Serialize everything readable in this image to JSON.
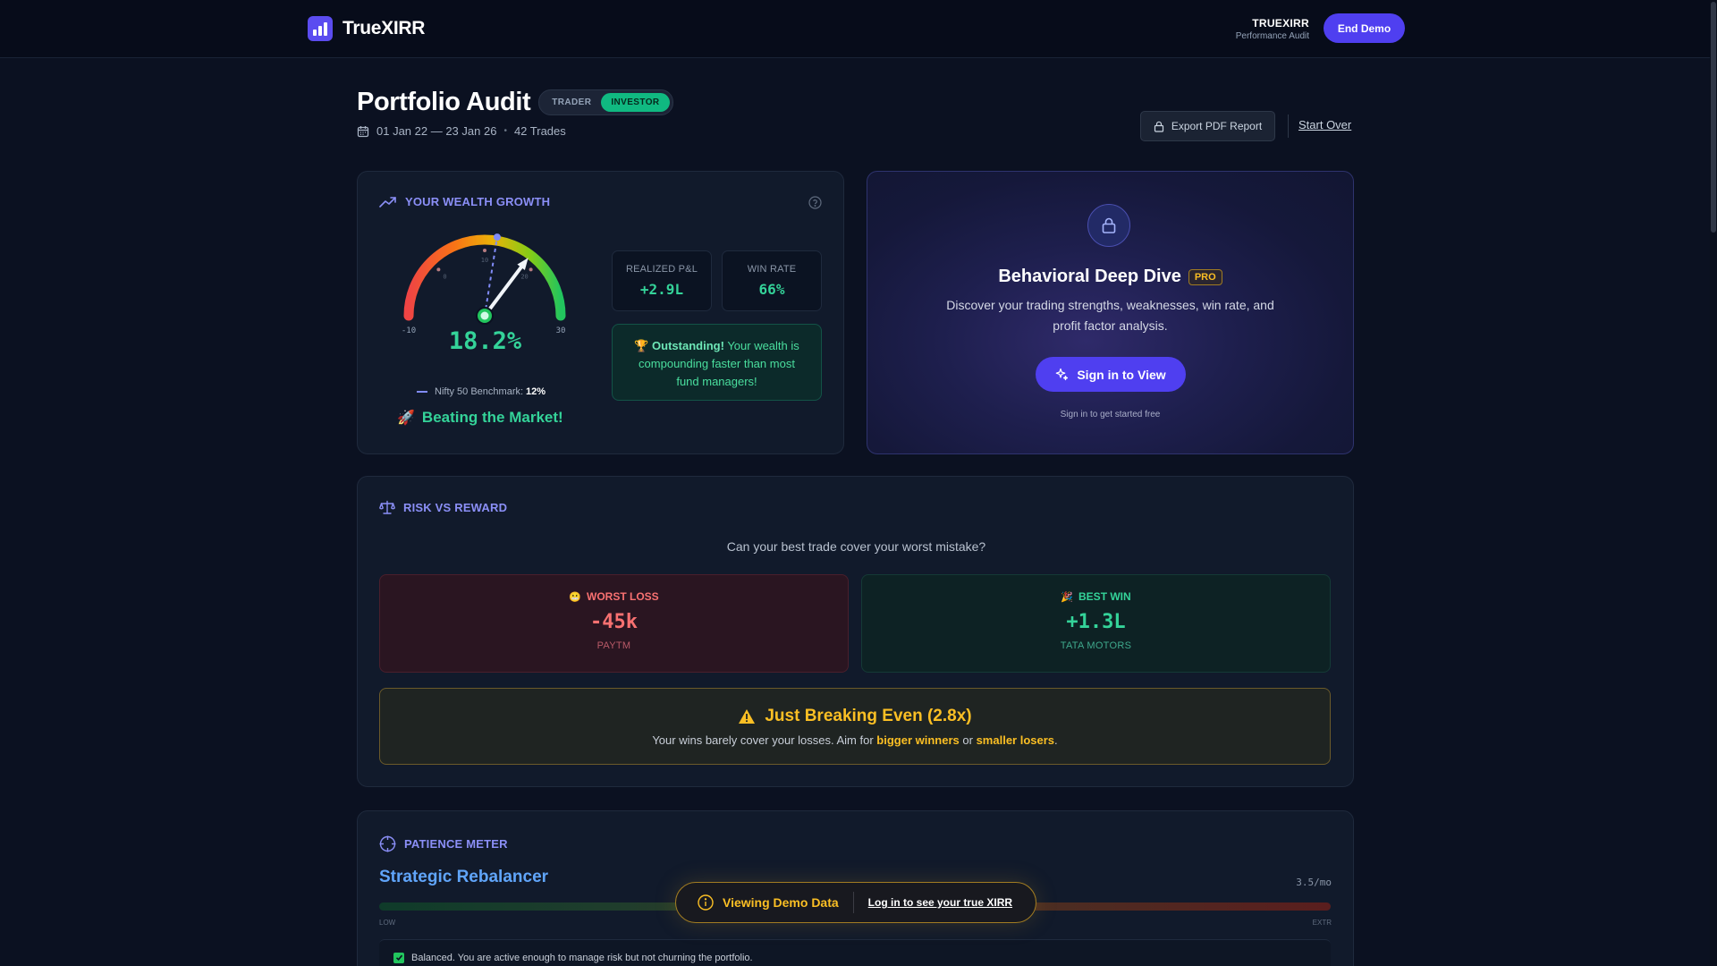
{
  "nav": {
    "logo_text": "TrueXIRR",
    "brand_title": "TRUEXIRR",
    "brand_subtitle": "Performance Audit",
    "end_demo_label": "End Demo"
  },
  "header": {
    "title": "Portfolio Audit",
    "mode_options": [
      "TRADER",
      "INVESTOR"
    ],
    "mode_selected": "INVESTOR",
    "date_range": "01 Jan 22 — 23 Jan 26",
    "separator": "•",
    "trade_count": "42 Trades",
    "export_label": "Export PDF Report",
    "start_over_label": "Start Over"
  },
  "wealth": {
    "heading": "YOUR WEALTH GROWTH",
    "gauge": {
      "value": 18.2,
      "display": "18.2%",
      "min": -10,
      "max": 30,
      "min_label": "-10",
      "max_label": "30",
      "benchmark_value": 12,
      "tick_labels": [
        "0",
        "10",
        "20"
      ]
    },
    "benchmark_label": "Nifty 50 Benchmark:",
    "benchmark_value": "12%",
    "beating_label": "Beating the Market!",
    "realized_label": "REALIZED P&L",
    "realized_value": "+2.9L",
    "winrate_label": "WIN RATE",
    "winrate_value": "66%",
    "outstanding_bold": "Outstanding!",
    "outstanding_text": "Your wealth is compounding faster than most fund managers!"
  },
  "behavioral": {
    "title": "Behavioral Deep Dive",
    "badge": "PRO",
    "description": "Discover your trading strengths, weaknesses, win rate, and profit factor analysis.",
    "button_label": "Sign in to View",
    "sub_text": "Sign in to get started free"
  },
  "risk": {
    "heading": "RISK VS REWARD",
    "question": "Can your best trade cover your worst mistake?",
    "worst_label": "WORST LOSS",
    "worst_value": "-45k",
    "worst_symbol": "PAYTM",
    "best_label": "BEST WIN",
    "best_value": "+1.3L",
    "best_symbol": "TATA MOTORS",
    "verdict_title": "Just Breaking Even (2.8x)",
    "verdict_prefix": "Your wins barely cover your losses. Aim for",
    "verdict_bold1": "bigger winners",
    "verdict_mid": "or",
    "verdict_bold2": "smaller losers",
    "verdict_suffix": "."
  },
  "patience": {
    "heading": "PATIENCE METER",
    "profile": "Strategic Rebalancer",
    "rate": "3.5/mo",
    "level": 0.3,
    "low_label": "LOW",
    "high_label": "EXTR",
    "note": "Balanced. You are active enough to manage risk but not churning the portfolio."
  },
  "demo_banner": {
    "label": "Viewing Demo Data",
    "cta": "Log in to see your true XIRR"
  },
  "colors": {
    "accent": "#4f3ff0",
    "positive": "#34d399",
    "negative": "#f87171",
    "warning": "#fbbf24",
    "heading": "#8b8ff7"
  }
}
